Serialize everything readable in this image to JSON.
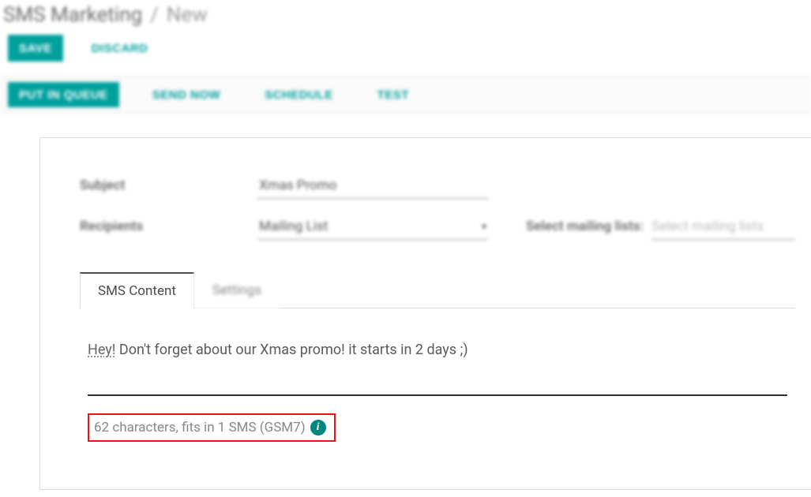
{
  "breadcrumb": {
    "root": "SMS Marketing",
    "sep": "/",
    "current": "New"
  },
  "edit_bar": {
    "save": "SAVE",
    "discard": "DISCARD"
  },
  "status_bar": {
    "put_in_queue": "PUT IN QUEUE",
    "send_now": "SEND NOW",
    "schedule": "SCHEDULE",
    "test": "TEST"
  },
  "form": {
    "subject_label": "Subject",
    "subject_value": "Xmas Promo",
    "recipients_label": "Recipients",
    "recipients_value": "Mailing List",
    "mailing_lists_label": "Select mailing lists:",
    "mailing_lists_placeholder": "Select mailing lists"
  },
  "tabs": {
    "sms_content": "SMS Content",
    "settings": "Settings"
  },
  "sms": {
    "firstword": "Hey!",
    "rest": " Don't forget about our Xmas promo! it starts in 2 days ;)",
    "counter": "62 characters, fits in 1 SMS (GSM7)",
    "info_glyph": "i"
  }
}
